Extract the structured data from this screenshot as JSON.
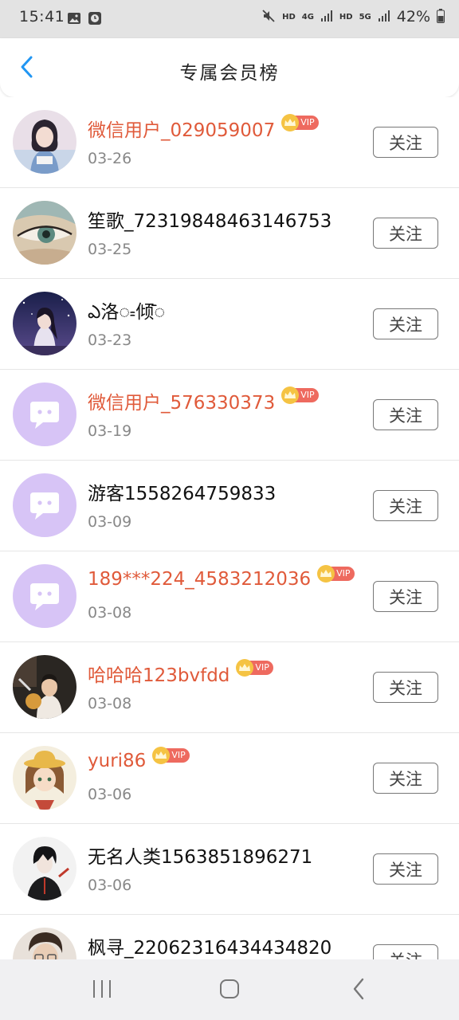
{
  "status_bar": {
    "time": "15:41",
    "net1": "HD",
    "net2": "4G",
    "net3": "HD",
    "net4": "5G",
    "battery": "42%"
  },
  "header": {
    "title": "专属会员榜"
  },
  "vip_badge_text": "VIP",
  "follow_label": "关注",
  "colors": {
    "vip_name": "#e05a3a",
    "accent_blue": "#2196f3",
    "vip_badge": "#ee6a5f",
    "crown": "#f5c343",
    "default_avatar": "#d7c4f6"
  },
  "members": [
    {
      "name": "微信用户_029059007",
      "date": "03-26",
      "vip": true,
      "avatar": "photo-girl-avatar"
    },
    {
      "name": "笙歌_72319848463146753",
      "date": "03-25",
      "vip": false,
      "avatar": "painted-eye-avatar"
    },
    {
      "name": "ఎ洛ᯫ倾ᯩ",
      "date": "03-23",
      "vip": false,
      "avatar": "night-sky-avatar"
    },
    {
      "name": "微信用户_576330373",
      "date": "03-19",
      "vip": true,
      "avatar": "default-chat-avatar"
    },
    {
      "name": "游客1558264759833",
      "date": "03-09",
      "vip": false,
      "avatar": "default-chat-avatar"
    },
    {
      "name": "189***224_4583212036",
      "date": "03-08",
      "vip": true,
      "avatar": "default-chat-avatar"
    },
    {
      "name": "哈哈哈123bvfdd",
      "date": "03-08",
      "vip": true,
      "avatar": "child-photo-avatar"
    },
    {
      "name": "yuri86",
      "date": "03-06",
      "vip": true,
      "avatar": "anime-girl-avatar"
    },
    {
      "name": "无名人类1563851896271",
      "date": "03-06",
      "vip": false,
      "avatar": "anime-boy-avatar"
    },
    {
      "name": "枫寻_22062316434434820",
      "date": "",
      "vip": false,
      "avatar": "photo-boy-avatar"
    }
  ]
}
